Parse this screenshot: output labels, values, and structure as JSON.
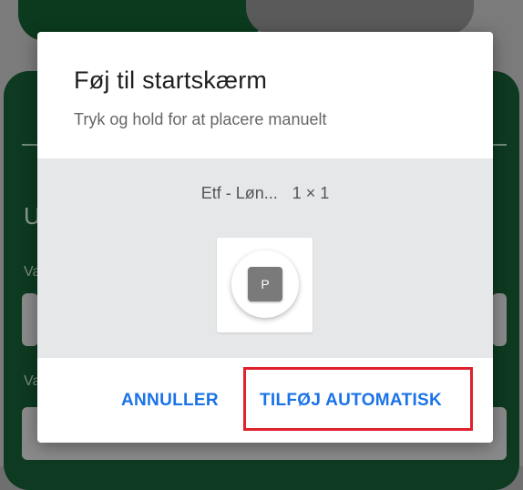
{
  "background": {
    "left_letter": "U",
    "small_labels": [
      "Va",
      "Va"
    ]
  },
  "dialog": {
    "title": "Føj til startskærm",
    "subtitle": "Tryk og hold for at placere manuelt",
    "widget": {
      "name": "Etf - Løn...",
      "size": "1 × 1",
      "icon_letter": "P"
    },
    "buttons": {
      "cancel": "ANNULLER",
      "add": "TILFØJ AUTOMATISK"
    }
  },
  "colors": {
    "accent": "#1a73e8",
    "highlight": "#e0202a",
    "app_green": "#0d3a20"
  }
}
